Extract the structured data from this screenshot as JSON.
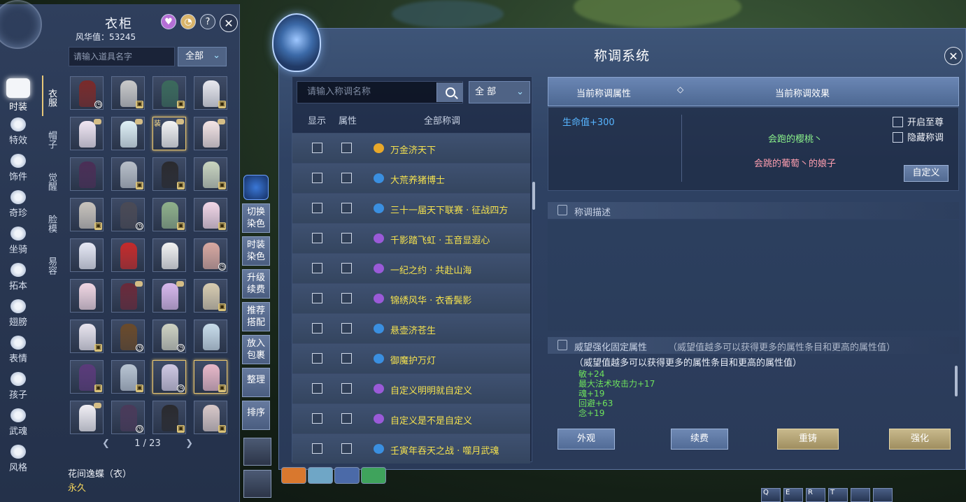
{
  "wardrobe": {
    "title": "衣柜",
    "fame_label": "风华值：53245",
    "search_placeholder": "请输入道具名字",
    "filter_label": "全部",
    "nav": [
      "时装",
      "特效",
      "饰件",
      "奇珍",
      "坐骑",
      "拓本",
      "翅膀",
      "表情",
      "孩子",
      "武魂",
      "风格"
    ],
    "categories": [
      "衣服",
      "帽子",
      "觉醒",
      "脸模",
      "易容"
    ],
    "page": "1 / 23",
    "selected_item_name": "花间逸蝶（衣）",
    "selected_item_duration": "永久",
    "equipped_tag": "装"
  },
  "vbar": {
    "buttons": [
      "切换\n染色",
      "时装\n染色",
      "升级\n续费",
      "推荐\n搭配",
      "放入\n包裹",
      "整理",
      "排序"
    ]
  },
  "title_system": {
    "title": "称调系统",
    "search_placeholder": "请输入称调名称",
    "filter_label": "全  部",
    "col_show": "显示",
    "col_attr": "属性",
    "col_all": "全部称调",
    "titles": [
      {
        "name": "万金济天下",
        "badge": "gold"
      },
      {
        "name": "大荒养猪博士",
        "badge": "blue"
      },
      {
        "name": "三十一届天下联赛 · 征战四方",
        "badge": "blue"
      },
      {
        "name": "千影踏飞虹 · 玉音显遐心",
        "badge": "purple"
      },
      {
        "name": "一纪之约 · 共赴山海",
        "badge": "purple"
      },
      {
        "name": "锦绣风华 · 衣香鬓影",
        "badge": "purple"
      },
      {
        "name": "悬壶济苍生",
        "badge": "blue"
      },
      {
        "name": "御魔护万灯",
        "badge": "blue"
      },
      {
        "name": "自定义明明就自定义",
        "badge": "purple"
      },
      {
        "name": "自定义是不是自定义",
        "badge": "purple"
      },
      {
        "name": "壬寅年吞天之战 · 噬月武魂",
        "badge": "blue"
      }
    ],
    "current_attr_label": "当前称调属性",
    "current_effect_label": "当前称调效果",
    "diamond": "◇",
    "hp_bonus": "生命值+300",
    "effect_line1": "会跑的樱桃丶",
    "effect_line2": "会跳的葡萄丶的娘子",
    "opt_max": "开启至尊",
    "opt_hide": "隐藏称调",
    "custom_button": "自定义",
    "desc_title": "称调描述",
    "prestige_title": "威望强化固定属性",
    "prestige_sub": "（威望值越多可以获得更多的属性条目和更高的属性值）",
    "prestige_note": "（威望值越多可以获得更多的属性条目和更高的属性值）",
    "prestige_stats": [
      "敏+24",
      "最大法术攻击力+17",
      "魂+19",
      "回避+63",
      "念+19"
    ],
    "buttons": {
      "appearance": "外观",
      "renew": "续费",
      "recast": "重铸",
      "enhance": "强化"
    }
  },
  "hotbar": {
    "keys": [
      "Q",
      "E",
      "R",
      "T",
      "",
      ""
    ]
  },
  "colors": {
    "title_yellow": "#f5e24e",
    "accent_gold": "#e6c46f",
    "stat_green": "#6ee25c"
  }
}
